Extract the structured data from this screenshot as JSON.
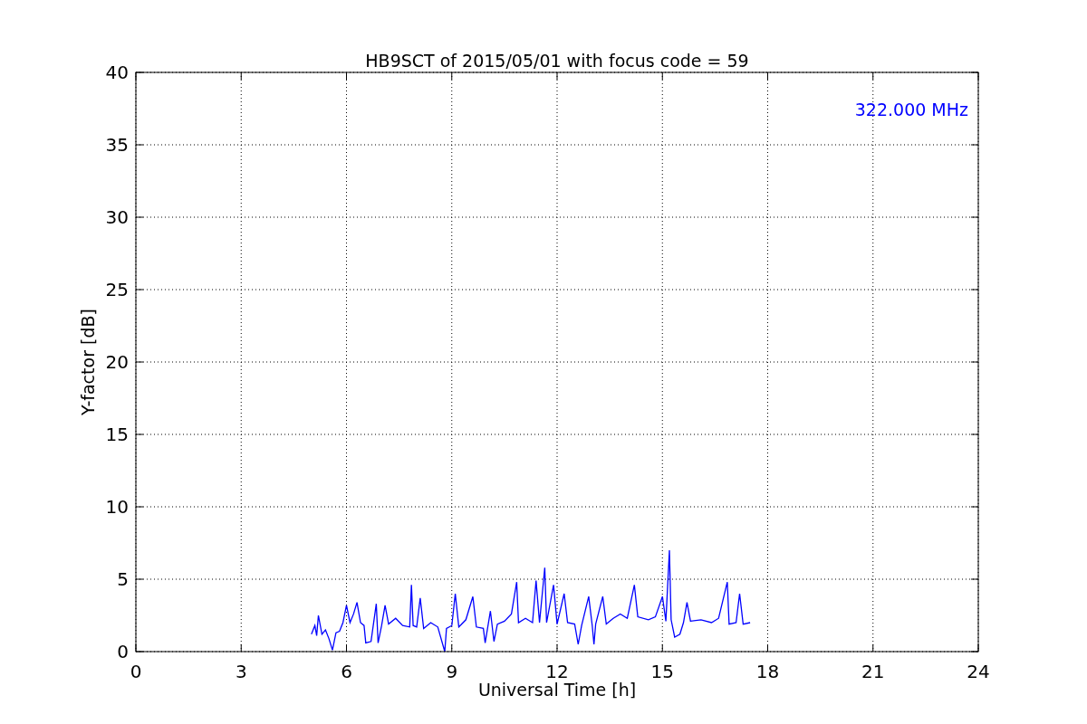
{
  "chart": {
    "chart_data": {
      "type": "line",
      "title": "HB9SCT of 2015/05/01 with focus code = 59",
      "xlabel": "Universal Time [h]",
      "ylabel": "Y-factor [dB]",
      "x": [
        5.0,
        5.1,
        5.15,
        5.2,
        5.3,
        5.4,
        5.5,
        5.6,
        5.7,
        5.8,
        5.9,
        6.0,
        6.1,
        6.2,
        6.3,
        6.4,
        6.5,
        6.55,
        6.7,
        6.85,
        6.9,
        7.0,
        7.1,
        7.2,
        7.4,
        7.6,
        7.8,
        7.85,
        7.9,
        8.0,
        8.1,
        8.2,
        8.4,
        8.6,
        8.8,
        8.85,
        9.0,
        9.1,
        9.2,
        9.4,
        9.6,
        9.7,
        9.9,
        9.95,
        10.1,
        10.2,
        10.3,
        10.5,
        10.7,
        10.85,
        10.9,
        11.1,
        11.3,
        11.4,
        11.5,
        11.65,
        11.7,
        11.9,
        12.0,
        12.2,
        12.3,
        12.5,
        12.6,
        12.7,
        12.9,
        13.0,
        13.05,
        13.1,
        13.3,
        13.4,
        13.6,
        13.8,
        14.0,
        14.2,
        14.3,
        14.6,
        14.8,
        15.0,
        15.1,
        15.2,
        15.25,
        15.35,
        15.5,
        15.6,
        15.7,
        15.8,
        16.1,
        16.4,
        16.6,
        16.85,
        16.9,
        17.1,
        17.2,
        17.3,
        17.5
      ],
      "series": [
        {
          "color": "#0000ff",
          "values": [
            1.2,
            1.8,
            1.1,
            2.5,
            1.2,
            1.5,
            0.9,
            0.1,
            1.3,
            1.4,
            2.0,
            3.2,
            2.0,
            2.6,
            3.4,
            2.0,
            1.8,
            0.6,
            0.7,
            3.3,
            0.6,
            1.8,
            3.2,
            1.9,
            2.3,
            1.8,
            1.7,
            4.6,
            1.8,
            1.7,
            3.7,
            1.6,
            2.0,
            1.7,
            0.0,
            1.6,
            1.8,
            4.0,
            1.7,
            2.2,
            3.8,
            1.7,
            1.6,
            0.6,
            2.8,
            0.7,
            1.9,
            2.1,
            2.6,
            4.8,
            2.0,
            2.3,
            2.0,
            4.9,
            2.0,
            5.8,
            2.0,
            4.6,
            1.9,
            4.0,
            2.0,
            1.9,
            0.5,
            1.8,
            3.8,
            1.8,
            0.5,
            1.9,
            3.8,
            1.9,
            2.3,
            2.6,
            2.3,
            4.6,
            2.4,
            2.2,
            2.4,
            3.8,
            2.1,
            7.0,
            2.2,
            1.0,
            1.2,
            2.0,
            3.4,
            2.1,
            2.2,
            2.0,
            2.3,
            4.8,
            1.9,
            2.0,
            4.0,
            1.9,
            2.0
          ]
        }
      ],
      "xlim": [
        0,
        24
      ],
      "ylim": [
        0,
        40
      ],
      "xticks": [
        0,
        3,
        6,
        9,
        12,
        15,
        18,
        21,
        24
      ],
      "yticks": [
        0,
        5,
        10,
        15,
        20,
        25,
        30,
        35,
        40
      ],
      "grid": true,
      "annotations": [
        {
          "text": "322.000 MHz"
        }
      ]
    }
  }
}
